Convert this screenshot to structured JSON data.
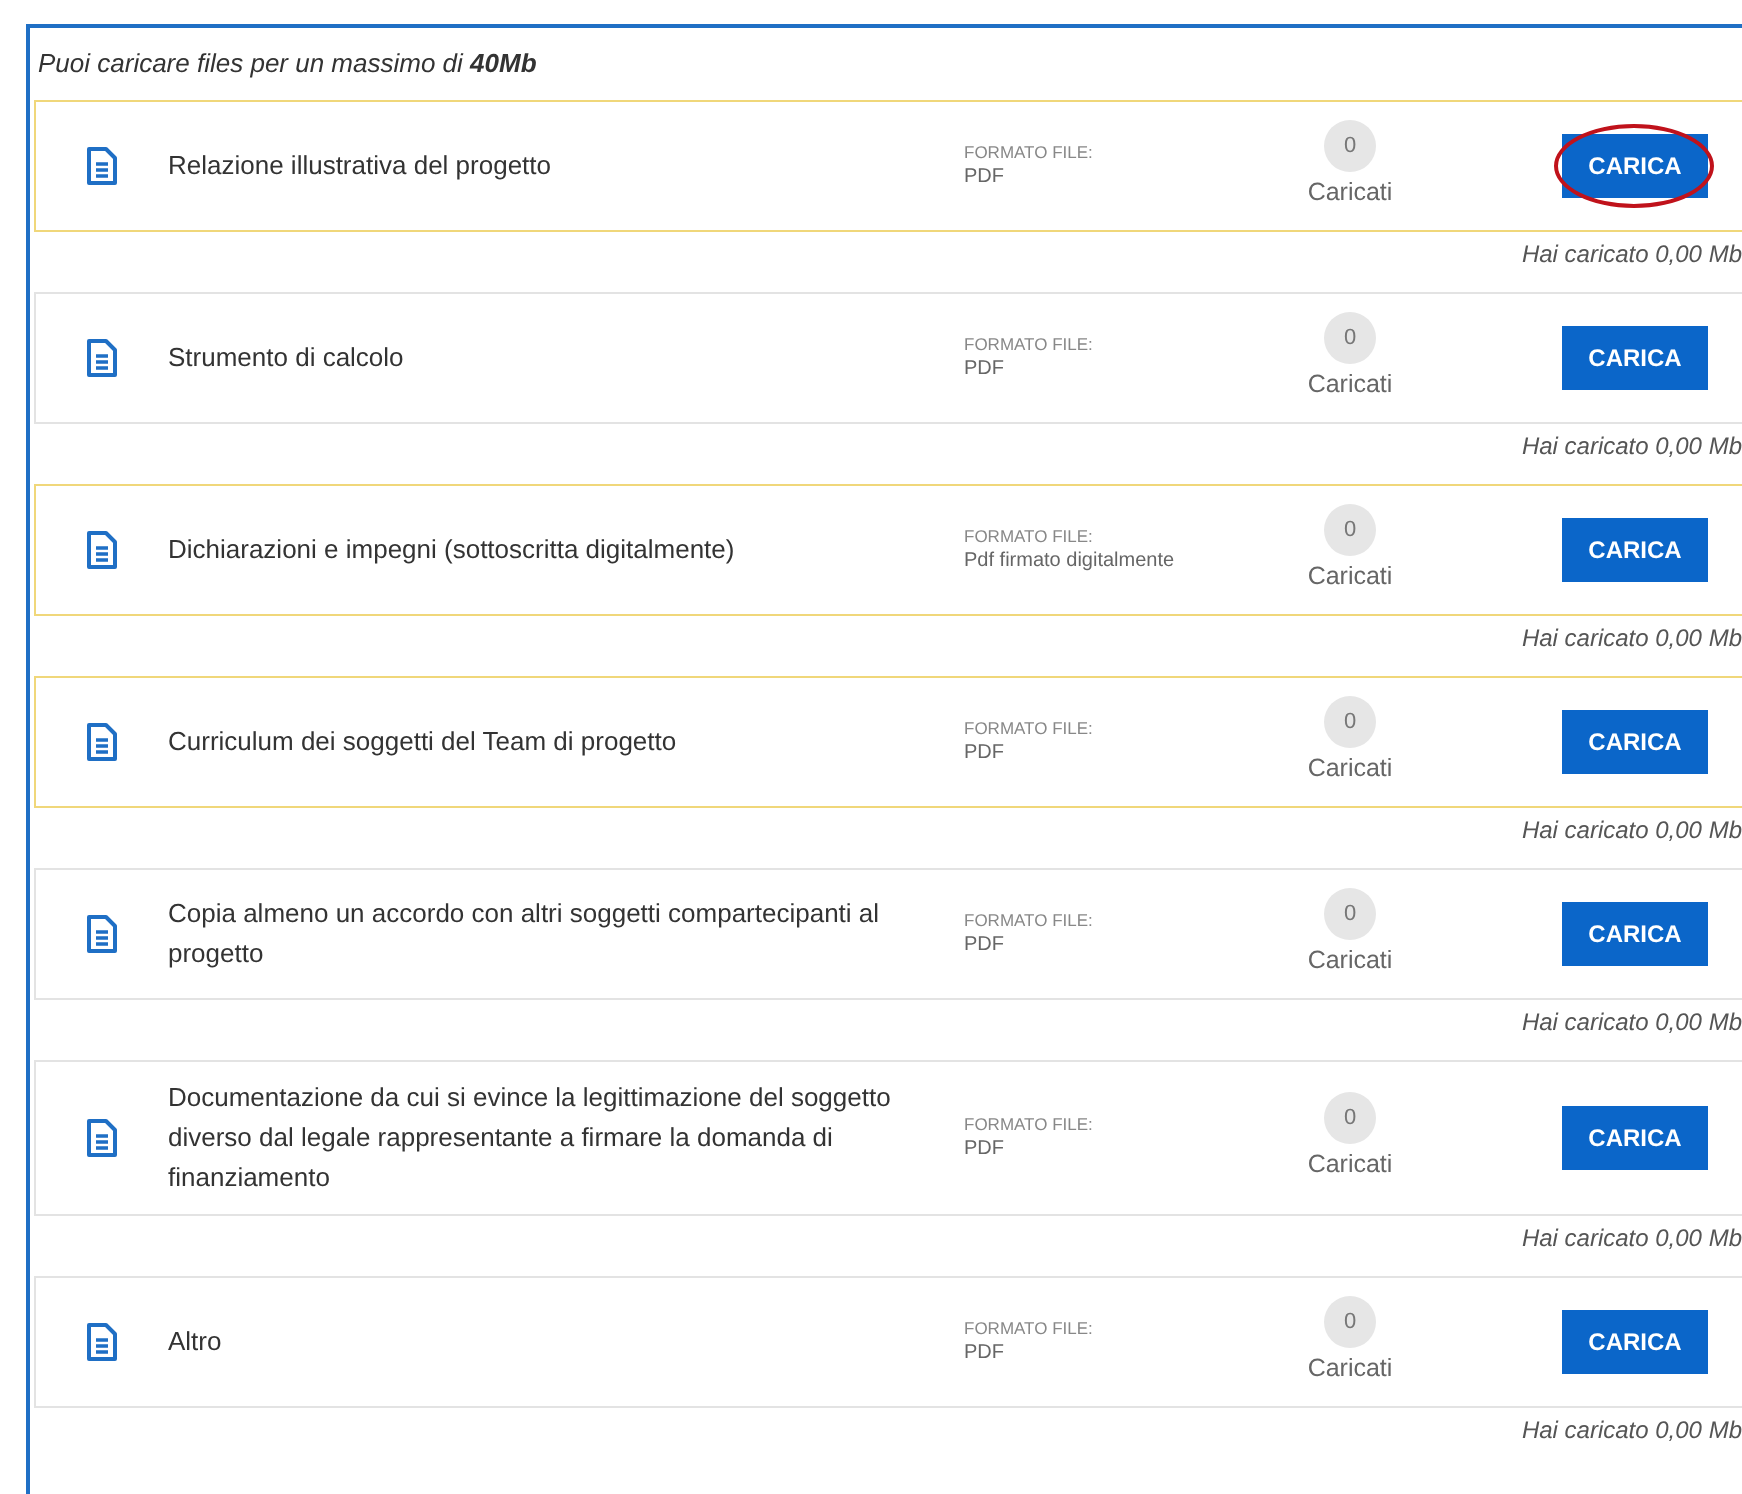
{
  "notice": "Puoi caricare files per un massimo di **40Mb**",
  "documents": [
    {
      "title": "Relazione illustrativa del progetto",
      "format_label": "FORMATO FILE:",
      "format": "PDF",
      "count": "0",
      "count_label": "Caricati",
      "button": "CARICA",
      "highlighted": true,
      "circled": true,
      "uploaded": "Hai caricato 0,00 Mb"
    },
    {
      "title": "Strumento di calcolo",
      "format_label": "FORMATO FILE:",
      "format": "PDF",
      "count": "0",
      "count_label": "Caricati",
      "button": "CARICA",
      "highlighted": false,
      "circled": false,
      "uploaded": "Hai caricato 0,00 Mb"
    },
    {
      "title": "Dichiarazioni e impegni (sottoscritta digitalmente)",
      "format_label": "FORMATO FILE:",
      "format": "Pdf firmato digitalmente",
      "count": "0",
      "count_label": "Caricati",
      "button": "CARICA",
      "highlighted": true,
      "circled": false,
      "uploaded": "Hai caricato 0,00 Mb"
    },
    {
      "title": "Curriculum dei soggetti del Team di progetto",
      "format_label": "FORMATO FILE:",
      "format": "PDF",
      "count": "0",
      "count_label": "Caricati",
      "button": "CARICA",
      "highlighted": true,
      "circled": false,
      "uploaded": "Hai caricato 0,00 Mb"
    },
    {
      "title": "Copia almeno un accordo con altri soggetti compartecipanti al progetto",
      "format_label": "FORMATO FILE:",
      "format": "PDF",
      "count": "0",
      "count_label": "Caricati",
      "button": "CARICA",
      "highlighted": false,
      "circled": false,
      "uploaded": "Hai caricato 0,00 Mb"
    },
    {
      "title": "Documentazione da cui si evince la legittimazione del soggetto diverso dal legale rappresentante a firmare la domanda di finanziamento",
      "format_label": "FORMATO FILE:",
      "format": "PDF",
      "count": "0",
      "count_label": "Caricati",
      "button": "CARICA",
      "highlighted": false,
      "circled": false,
      "uploaded": "Hai caricato 0,00 Mb"
    },
    {
      "title": "Altro",
      "format_label": "FORMATO FILE:",
      "format": "PDF",
      "count": "0",
      "count_label": "Caricati",
      "button": "CARICA",
      "highlighted": false,
      "circled": false,
      "uploaded": "Hai caricato 0,00 Mb"
    }
  ]
}
